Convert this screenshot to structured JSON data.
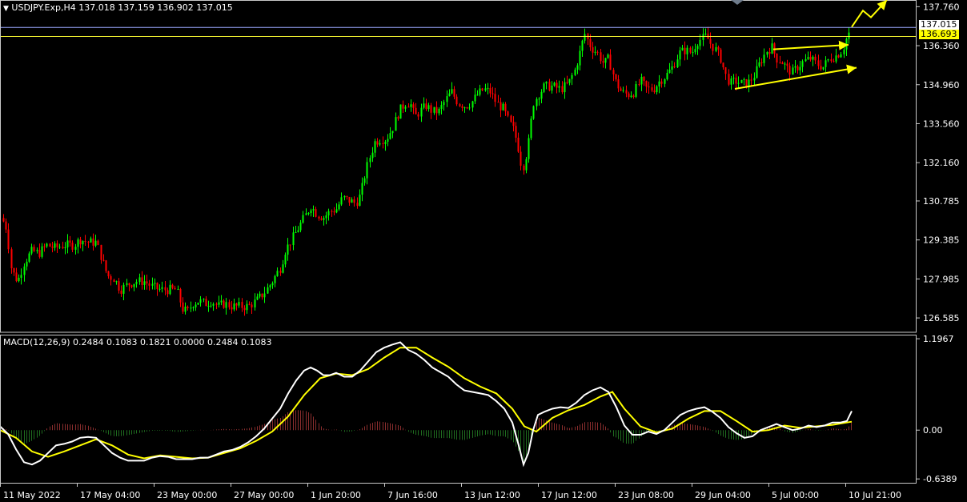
{
  "header": {
    "symbol_label": "USDJPY.Exp,H4",
    "ohlc": "137.018 137.159 136.902 137.015"
  },
  "macd_header": {
    "label": "MACD(12,26,9)",
    "values": "0.2484 0.1083 0.1821 0.0000 0.2484 0.1083"
  },
  "colors": {
    "background": "#000000",
    "bull": "#00ff00",
    "bear": "#ff0000",
    "axis": "#c8c8c8",
    "macd_line": "#ffffff",
    "signal_line": "#ffff00",
    "hist_pos": "#8b2e2e",
    "hist_neg": "#1f6b1f",
    "arrow": "#ffff00",
    "ask_line": "#9aa7ff",
    "bid_line": "#ffff33"
  },
  "price_tags": {
    "ask": "137.015",
    "bid": "136.693"
  },
  "chart_data": [
    {
      "type": "candlestick",
      "title": "USDJPY.Exp,H4",
      "x_tick_labels": [
        "11 May 2022",
        "17 May 04:00",
        "23 May 00:00",
        "27 May 00:00",
        "1 Jun 20:00",
        "7 Jun 16:00",
        "13 Jun 12:00",
        "17 Jun 12:00",
        "23 Jun 08:00",
        "29 Jun 04:00",
        "5 Jul 00:00",
        "10 Jul 21:00"
      ],
      "y_tick_labels": [
        "137.760",
        "136.360",
        "134.960",
        "133.560",
        "132.160",
        "130.785",
        "129.385",
        "127.985",
        "126.585"
      ],
      "ylim": [
        126.07,
        138.0
      ],
      "close_path": [
        [
          0,
          130.3
        ],
        [
          8,
          129.8
        ],
        [
          14,
          128.3
        ],
        [
          22,
          127.9
        ],
        [
          30,
          128.6
        ],
        [
          40,
          129.0
        ],
        [
          48,
          128.9
        ],
        [
          58,
          129.2
        ],
        [
          68,
          129.1
        ],
        [
          80,
          129.2
        ],
        [
          92,
          129.2
        ],
        [
          100,
          129.4
        ],
        [
          110,
          129.3
        ],
        [
          120,
          129.3
        ],
        [
          128,
          128.6
        ],
        [
          134,
          128.1
        ],
        [
          142,
          128.0
        ],
        [
          150,
          127.6
        ],
        [
          160,
          127.8
        ],
        [
          170,
          127.9
        ],
        [
          180,
          127.9
        ],
        [
          190,
          127.7
        ],
        [
          200,
          127.6
        ],
        [
          210,
          127.6
        ],
        [
          220,
          127.6
        ],
        [
          228,
          126.9
        ],
        [
          234,
          126.8
        ],
        [
          240,
          127.1
        ],
        [
          248,
          127.2
        ],
        [
          256,
          127.1
        ],
        [
          264,
          127.2
        ],
        [
          272,
          127.0
        ],
        [
          280,
          127.1
        ],
        [
          290,
          127.0
        ],
        [
          300,
          127.0
        ],
        [
          310,
          127.0
        ],
        [
          320,
          127.2
        ],
        [
          330,
          127.5
        ],
        [
          340,
          127.9
        ],
        [
          350,
          128.4
        ],
        [
          356,
          129.0
        ],
        [
          364,
          129.4
        ],
        [
          372,
          129.8
        ],
        [
          380,
          130.2
        ],
        [
          388,
          130.6
        ],
        [
          396,
          130.3
        ],
        [
          404,
          130.2
        ],
        [
          412,
          130.4
        ],
        [
          420,
          130.5
        ],
        [
          428,
          130.9
        ],
        [
          436,
          130.8
        ],
        [
          444,
          130.7
        ],
        [
          450,
          131.0
        ],
        [
          456,
          131.8
        ],
        [
          462,
          132.4
        ],
        [
          468,
          132.9
        ],
        [
          474,
          133.0
        ],
        [
          482,
          133.0
        ],
        [
          490,
          133.4
        ],
        [
          498,
          134.0
        ],
        [
          506,
          134.3
        ],
        [
          512,
          134.3
        ],
        [
          518,
          133.8
        ],
        [
          524,
          134.0
        ],
        [
          532,
          134.2
        ],
        [
          540,
          134.0
        ],
        [
          548,
          134.0
        ],
        [
          556,
          134.4
        ],
        [
          564,
          134.7
        ],
        [
          572,
          134.3
        ],
        [
          580,
          134.2
        ],
        [
          588,
          134.3
        ],
        [
          596,
          134.6
        ],
        [
          604,
          134.8
        ],
        [
          612,
          134.7
        ],
        [
          620,
          134.3
        ],
        [
          628,
          134.1
        ],
        [
          636,
          133.6
        ],
        [
          642,
          133.3
        ],
        [
          648,
          132.6
        ],
        [
          652,
          131.9
        ],
        [
          656,
          132.3
        ],
        [
          660,
          132.9
        ],
        [
          666,
          134.3
        ],
        [
          672,
          134.6
        ],
        [
          680,
          134.9
        ],
        [
          690,
          134.9
        ],
        [
          700,
          134.8
        ],
        [
          710,
          135.0
        ],
        [
          718,
          135.5
        ],
        [
          724,
          136.1
        ],
        [
          730,
          136.8
        ],
        [
          738,
          136.3
        ],
        [
          746,
          136.1
        ],
        [
          754,
          135.7
        ],
        [
          760,
          135.9
        ],
        [
          768,
          135.1
        ],
        [
          776,
          134.7
        ],
        [
          784,
          134.6
        ],
        [
          792,
          134.7
        ],
        [
          800,
          135.1
        ],
        [
          808,
          134.8
        ],
        [
          816,
          134.8
        ],
        [
          824,
          135.1
        ],
        [
          832,
          135.3
        ],
        [
          840,
          135.6
        ],
        [
          848,
          136.1
        ],
        [
          856,
          136.2
        ],
        [
          864,
          136.1
        ],
        [
          870,
          136.5
        ],
        [
          876,
          136.6
        ],
        [
          882,
          136.7
        ],
        [
          888,
          136.4
        ],
        [
          894,
          136.2
        ],
        [
          900,
          135.9
        ],
        [
          906,
          135.3
        ],
        [
          912,
          135.0
        ],
        [
          918,
          135.1
        ],
        [
          926,
          135.0
        ],
        [
          934,
          135.0
        ],
        [
          942,
          135.3
        ],
        [
          950,
          135.8
        ],
        [
          958,
          136.2
        ],
        [
          964,
          136.3
        ],
        [
          970,
          135.9
        ],
        [
          976,
          135.8
        ],
        [
          984,
          135.5
        ],
        [
          990,
          135.4
        ],
        [
          996,
          135.6
        ],
        [
          1004,
          135.8
        ],
        [
          1012,
          135.9
        ],
        [
          1020,
          135.7
        ],
        [
          1028,
          135.6
        ],
        [
          1036,
          135.9
        ],
        [
          1044,
          136.0
        ],
        [
          1052,
          136.2
        ],
        [
          1058,
          136.7
        ],
        [
          1064,
          137.0
        ]
      ],
      "annotations": [
        {
          "type": "arrow",
          "from": [
            966,
            136.23
          ],
          "to": [
            1060,
            136.39
          ]
        },
        {
          "type": "arrow",
          "from": [
            918,
            134.81
          ],
          "to": [
            1070,
            135.57
          ]
        },
        {
          "type": "polyline-arrow",
          "points": [
            [
              1064,
              137.03
            ],
            [
              1078,
              137.62
            ],
            [
              1088,
              137.38
            ],
            [
              1108,
              138.0
            ]
          ]
        }
      ]
    },
    {
      "type": "macd",
      "params": "12,26,9",
      "y_tick_labels": [
        "1.1967",
        "0.00",
        "-0.6389"
      ],
      "ylim": [
        -0.7,
        1.25
      ],
      "macd": [
        [
          0,
          0.05
        ],
        [
          10,
          -0.05
        ],
        [
          20,
          -0.25
        ],
        [
          30,
          -0.42
        ],
        [
          40,
          -0.45
        ],
        [
          50,
          -0.4
        ],
        [
          60,
          -0.3
        ],
        [
          70,
          -0.2
        ],
        [
          80,
          -0.18
        ],
        [
          90,
          -0.15
        ],
        [
          100,
          -0.1
        ],
        [
          110,
          -0.09
        ],
        [
          120,
          -0.1
        ],
        [
          130,
          -0.2
        ],
        [
          140,
          -0.3
        ],
        [
          150,
          -0.36
        ],
        [
          160,
          -0.4
        ],
        [
          170,
          -0.4
        ],
        [
          180,
          -0.4
        ],
        [
          190,
          -0.36
        ],
        [
          200,
          -0.34
        ],
        [
          210,
          -0.35
        ],
        [
          220,
          -0.38
        ],
        [
          230,
          -0.38
        ],
        [
          240,
          -0.38
        ],
        [
          250,
          -0.36
        ],
        [
          260,
          -0.36
        ],
        [
          270,
          -0.32
        ],
        [
          280,
          -0.28
        ],
        [
          290,
          -0.26
        ],
        [
          300,
          -0.22
        ],
        [
          310,
          -0.16
        ],
        [
          320,
          -0.08
        ],
        [
          330,
          0.02
        ],
        [
          340,
          0.15
        ],
        [
          350,
          0.28
        ],
        [
          360,
          0.48
        ],
        [
          370,
          0.65
        ],
        [
          380,
          0.78
        ],
        [
          388,
          0.82
        ],
        [
          396,
          0.78
        ],
        [
          404,
          0.72
        ],
        [
          412,
          0.72
        ],
        [
          420,
          0.75
        ],
        [
          430,
          0.7
        ],
        [
          440,
          0.7
        ],
        [
          450,
          0.78
        ],
        [
          460,
          0.9
        ],
        [
          470,
          1.02
        ],
        [
          480,
          1.08
        ],
        [
          490,
          1.12
        ],
        [
          500,
          1.15
        ],
        [
          510,
          1.05
        ],
        [
          520,
          1.0
        ],
        [
          530,
          0.92
        ],
        [
          540,
          0.82
        ],
        [
          550,
          0.76
        ],
        [
          560,
          0.7
        ],
        [
          570,
          0.6
        ],
        [
          580,
          0.52
        ],
        [
          590,
          0.5
        ],
        [
          600,
          0.48
        ],
        [
          610,
          0.46
        ],
        [
          620,
          0.38
        ],
        [
          630,
          0.28
        ],
        [
          640,
          0.1
        ],
        [
          648,
          -0.2
        ],
        [
          654,
          -0.45
        ],
        [
          660,
          -0.3
        ],
        [
          666,
          0.0
        ],
        [
          672,
          0.2
        ],
        [
          680,
          0.24
        ],
        [
          690,
          0.28
        ],
        [
          700,
          0.3
        ],
        [
          710,
          0.29
        ],
        [
          720,
          0.36
        ],
        [
          730,
          0.46
        ],
        [
          740,
          0.52
        ],
        [
          750,
          0.56
        ],
        [
          760,
          0.5
        ],
        [
          770,
          0.3
        ],
        [
          780,
          0.06
        ],
        [
          790,
          -0.06
        ],
        [
          800,
          -0.06
        ],
        [
          810,
          -0.02
        ],
        [
          820,
          -0.05
        ],
        [
          830,
          0.0
        ],
        [
          840,
          0.1
        ],
        [
          850,
          0.2
        ],
        [
          860,
          0.25
        ],
        [
          870,
          0.28
        ],
        [
          880,
          0.3
        ],
        [
          890,
          0.24
        ],
        [
          900,
          0.16
        ],
        [
          910,
          0.04
        ],
        [
          920,
          -0.04
        ],
        [
          930,
          -0.1
        ],
        [
          940,
          -0.08
        ],
        [
          950,
          0.0
        ],
        [
          960,
          0.04
        ],
        [
          970,
          0.08
        ],
        [
          980,
          0.04
        ],
        [
          990,
          0.0
        ],
        [
          1000,
          0.02
        ],
        [
          1010,
          0.06
        ],
        [
          1020,
          0.04
        ],
        [
          1030,
          0.06
        ],
        [
          1040,
          0.1
        ],
        [
          1050,
          0.1
        ],
        [
          1058,
          0.12
        ],
        [
          1064,
          0.25
        ]
      ],
      "signal": [
        [
          0,
          0.0
        ],
        [
          20,
          -0.1
        ],
        [
          40,
          -0.28
        ],
        [
          60,
          -0.35
        ],
        [
          80,
          -0.28
        ],
        [
          100,
          -0.2
        ],
        [
          120,
          -0.12
        ],
        [
          140,
          -0.2
        ],
        [
          160,
          -0.32
        ],
        [
          180,
          -0.37
        ],
        [
          200,
          -0.33
        ],
        [
          220,
          -0.35
        ],
        [
          240,
          -0.37
        ],
        [
          260,
          -0.36
        ],
        [
          280,
          -0.3
        ],
        [
          300,
          -0.24
        ],
        [
          320,
          -0.14
        ],
        [
          340,
          -0.02
        ],
        [
          360,
          0.18
        ],
        [
          380,
          0.46
        ],
        [
          400,
          0.68
        ],
        [
          420,
          0.74
        ],
        [
          440,
          0.72
        ],
        [
          460,
          0.8
        ],
        [
          480,
          0.95
        ],
        [
          500,
          1.08
        ],
        [
          520,
          1.08
        ],
        [
          540,
          0.95
        ],
        [
          560,
          0.83
        ],
        [
          580,
          0.68
        ],
        [
          600,
          0.57
        ],
        [
          620,
          0.48
        ],
        [
          640,
          0.28
        ],
        [
          655,
          0.05
        ],
        [
          670,
          -0.02
        ],
        [
          690,
          0.16
        ],
        [
          710,
          0.26
        ],
        [
          730,
          0.33
        ],
        [
          750,
          0.44
        ],
        [
          765,
          0.5
        ],
        [
          780,
          0.28
        ],
        [
          800,
          0.05
        ],
        [
          820,
          -0.03
        ],
        [
          840,
          0.02
        ],
        [
          860,
          0.15
        ],
        [
          880,
          0.25
        ],
        [
          900,
          0.25
        ],
        [
          920,
          0.12
        ],
        [
          940,
          -0.02
        ],
        [
          960,
          0.0
        ],
        [
          980,
          0.06
        ],
        [
          1000,
          0.03
        ],
        [
          1020,
          0.05
        ],
        [
          1040,
          0.07
        ],
        [
          1064,
          0.11
        ]
      ]
    }
  ]
}
